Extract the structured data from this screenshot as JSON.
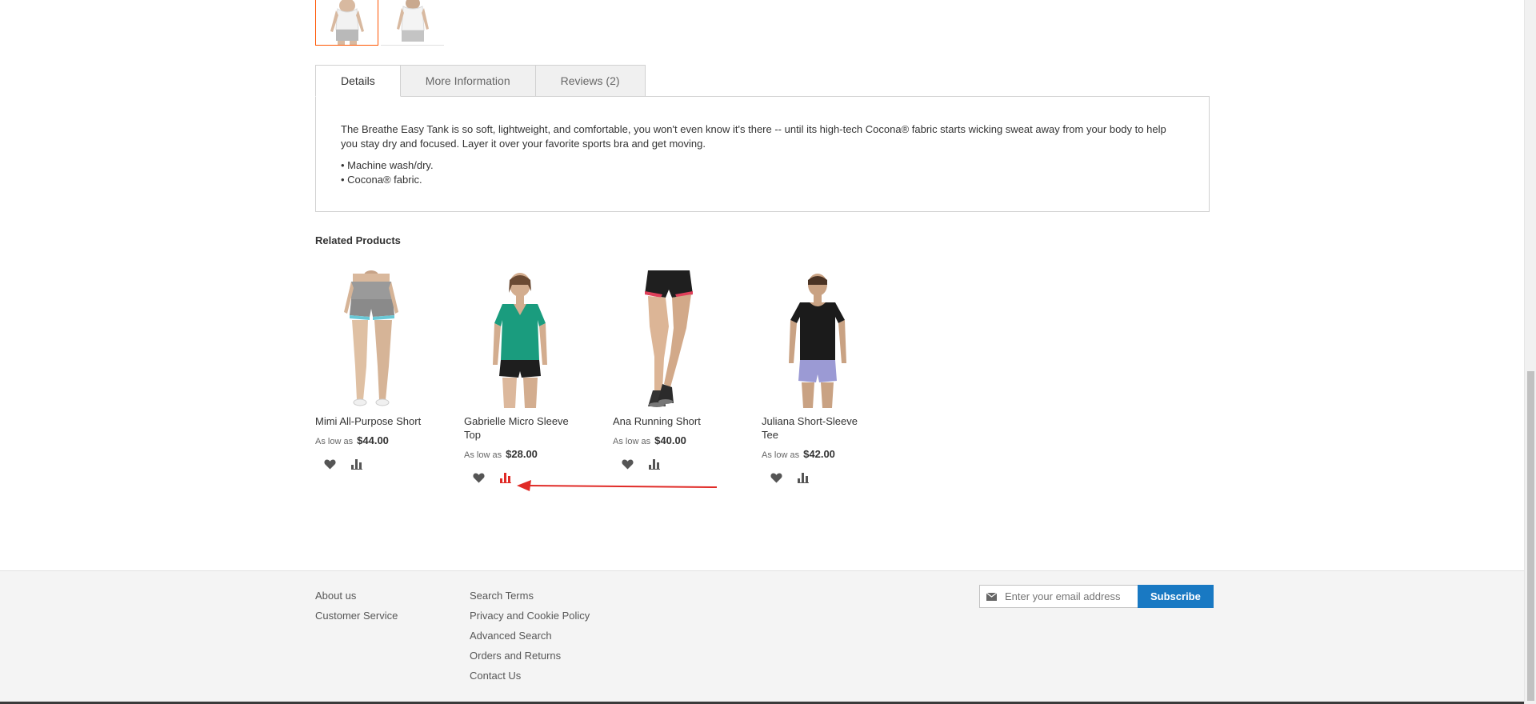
{
  "gallery": {
    "thumbnails": [
      {
        "alt": "Tank front view",
        "active": true
      },
      {
        "alt": "Tank back view",
        "active": false
      }
    ]
  },
  "tabs": [
    {
      "label": "Details",
      "active": true
    },
    {
      "label": "More Information",
      "active": false
    },
    {
      "label": "Reviews (2)",
      "active": false
    }
  ],
  "details": {
    "description": "The Breathe Easy Tank is so soft, lightweight, and comfortable, you won't even know it's there -- until its high-tech Cocona® fabric starts wicking sweat away from your body to help you stay dry and focused. Layer it over your favorite sports bra and get moving.",
    "bullets": [
      "• Machine wash/dry.",
      "• Cocona® fabric."
    ]
  },
  "related": {
    "title": "Related Products",
    "products": [
      {
        "name": "Mimi All-Purpose Short",
        "price_prefix": "As low as",
        "price": "$44.00"
      },
      {
        "name": "Gabrielle Micro Sleeve Top",
        "price_prefix": "As low as",
        "price": "$28.00",
        "highlighted_action": "compare"
      },
      {
        "name": "Ana Running Short",
        "price_prefix": "As low as",
        "price": "$40.00"
      },
      {
        "name": "Juliana Short-Sleeve Tee",
        "price_prefix": "As low as",
        "price": "$42.00"
      }
    ]
  },
  "footer": {
    "col1": [
      "About us",
      "Customer Service"
    ],
    "col2": [
      "Search Terms",
      "Privacy and Cookie Policy",
      "Advanced Search",
      "Orders and Returns",
      "Contact Us"
    ],
    "newsletter": {
      "placeholder": "Enter your email address",
      "button": "Subscribe"
    }
  },
  "colors": {
    "accent": "#1979c3",
    "active_thumb_border": "#ff5501",
    "annotation": "#e02b27",
    "icon": "#555555"
  },
  "icons": {
    "wishlist": "heart-icon",
    "compare": "bar-chart-icon",
    "email": "envelope-icon"
  }
}
